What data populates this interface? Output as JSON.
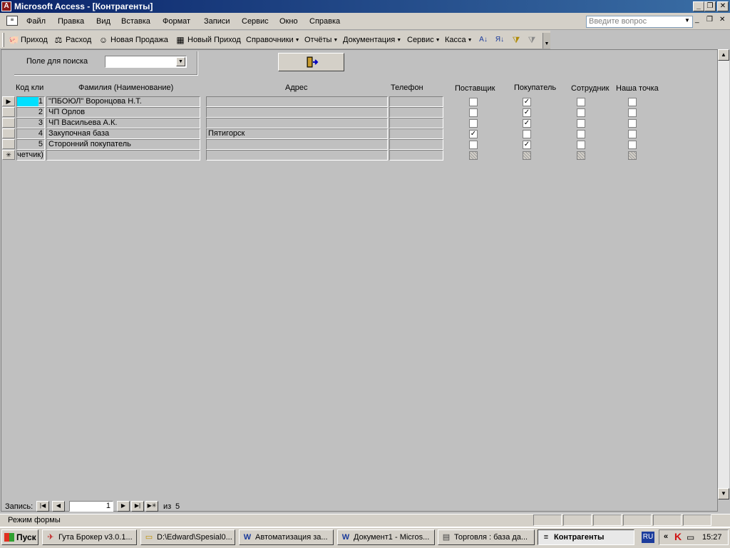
{
  "window": {
    "title": "Microsoft Access - [Контрагенты]",
    "min": "_",
    "max": "❐",
    "close": "✕"
  },
  "menu": {
    "items": [
      "Файл",
      "Правка",
      "Вид",
      "Вставка",
      "Формат",
      "Записи",
      "Сервис",
      "Окно",
      "Справка"
    ],
    "ask_placeholder": "Введите вопрос"
  },
  "toolbar": {
    "items": [
      "Приход",
      "Расход",
      "Новая Продажа",
      "Новый Приход",
      "Справочники",
      "Отчёты",
      "Документация",
      "Сервис",
      "Касса"
    ]
  },
  "form": {
    "search_label": "Поле для поиска",
    "search_value": "",
    "columns": [
      "Код кли",
      "Фамилия (Наименование)",
      "Адрес",
      "Телефон",
      "Поставщик",
      "Покупатель",
      "Сотрудник",
      "Наша точка"
    ],
    "rows": [
      {
        "id": "1",
        "name": "\"ПБОЮЛ\" Воронцова Н.Т.",
        "address": "",
        "phone": "",
        "supplier": false,
        "buyer": true,
        "employee": false,
        "our_point": false
      },
      {
        "id": "2",
        "name": "ЧП Орлов",
        "address": "",
        "phone": "",
        "supplier": false,
        "buyer": true,
        "employee": false,
        "our_point": false
      },
      {
        "id": "3",
        "name": "ЧП Васильева А.К.",
        "address": "",
        "phone": "",
        "supplier": false,
        "buyer": true,
        "employee": false,
        "our_point": false
      },
      {
        "id": "4",
        "name": "Закупочная база",
        "address": "Пятигорск",
        "phone": "",
        "supplier": true,
        "buyer": false,
        "employee": false,
        "our_point": false
      },
      {
        "id": "5",
        "name": "Сторонний покупатель",
        "address": "",
        "phone": "",
        "supplier": false,
        "buyer": true,
        "employee": false,
        "our_point": false
      }
    ],
    "new_row_id": "четчик)"
  },
  "navigator": {
    "label": "Запись:",
    "current": "1",
    "of_label": "из",
    "total": "5"
  },
  "status": {
    "text": "Режим формы"
  },
  "taskbar": {
    "start": "Пуск",
    "tasks": [
      "Гута Брокер v3.0.1...",
      "D:\\Edward\\Spesial0...",
      "Автоматизация за...",
      "Документ1 - Micros...",
      "Торговля : база да...",
      "Контрагенты"
    ],
    "lang": "RU",
    "time": "15:27"
  }
}
